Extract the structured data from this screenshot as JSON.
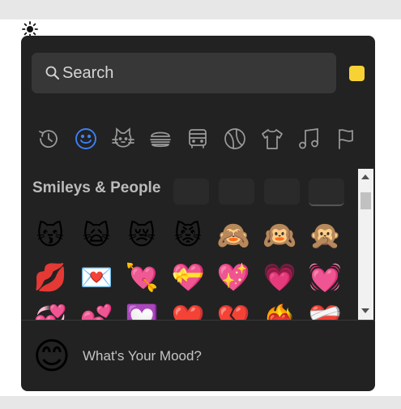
{
  "theme_icon": "sun-icon",
  "search": {
    "placeholder": "Search",
    "icon": "search-icon"
  },
  "skin_tone_color": "#f7d234",
  "accent_color": "#3b82f6",
  "categories": [
    {
      "name": "recent",
      "icon": "clock-icon",
      "active": false
    },
    {
      "name": "smileys-people",
      "icon": "smiley-icon",
      "active": true
    },
    {
      "name": "animals-nature",
      "icon": "cat-icon",
      "active": false
    },
    {
      "name": "food-drink",
      "icon": "burger-icon",
      "active": false
    },
    {
      "name": "travel-places",
      "icon": "bus-icon",
      "active": false
    },
    {
      "name": "activities",
      "icon": "ball-icon",
      "active": false
    },
    {
      "name": "objects",
      "icon": "shirt-icon",
      "active": false
    },
    {
      "name": "symbols",
      "icon": "music-note-icon",
      "active": false
    },
    {
      "name": "flags",
      "icon": "flag-icon",
      "active": false
    }
  ],
  "section_title": "Smileys & People",
  "emoji_rows": [
    [
      "😽",
      "🙀",
      "😿",
      "😾",
      "🙈",
      "🙉",
      "🙊"
    ],
    [
      "💋",
      "💌",
      "💘",
      "💝",
      "💖",
      "💗",
      "💓"
    ],
    [
      "💞",
      "💕",
      "💟",
      "❤️",
      "💔",
      "❤️‍🔥",
      "❤️‍🩹"
    ]
  ],
  "footer": {
    "preview_emoji": "😊",
    "mood_text": "What's Your Mood?"
  }
}
